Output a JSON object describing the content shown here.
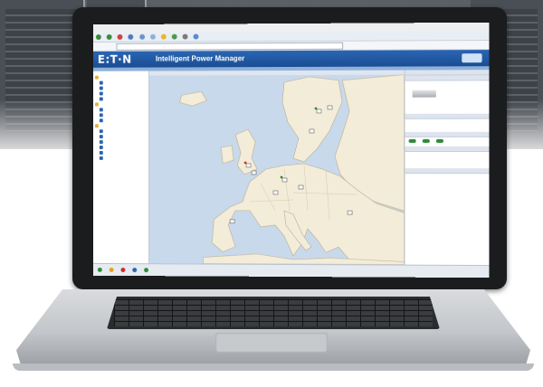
{
  "colors": {
    "brand_blue": "#1a4d93",
    "status_ok": "#2e8b3a",
    "status_warning": "#e3a21a",
    "status_critical": "#d02a2a",
    "status_unknown": "#2a65b3",
    "sea": "#c9d9ec",
    "land": "#f3ecd9"
  },
  "banner": {
    "logo": "E:T·N",
    "title": "Intelligent Power Manager"
  },
  "icons": {
    "menu": "document-icon",
    "refresh": "refresh-icon",
    "home": "home-icon",
    "search": "search-icon",
    "favorites": "star-icon",
    "device": "ups-device-icon",
    "tree_folder": "folder-icon"
  }
}
